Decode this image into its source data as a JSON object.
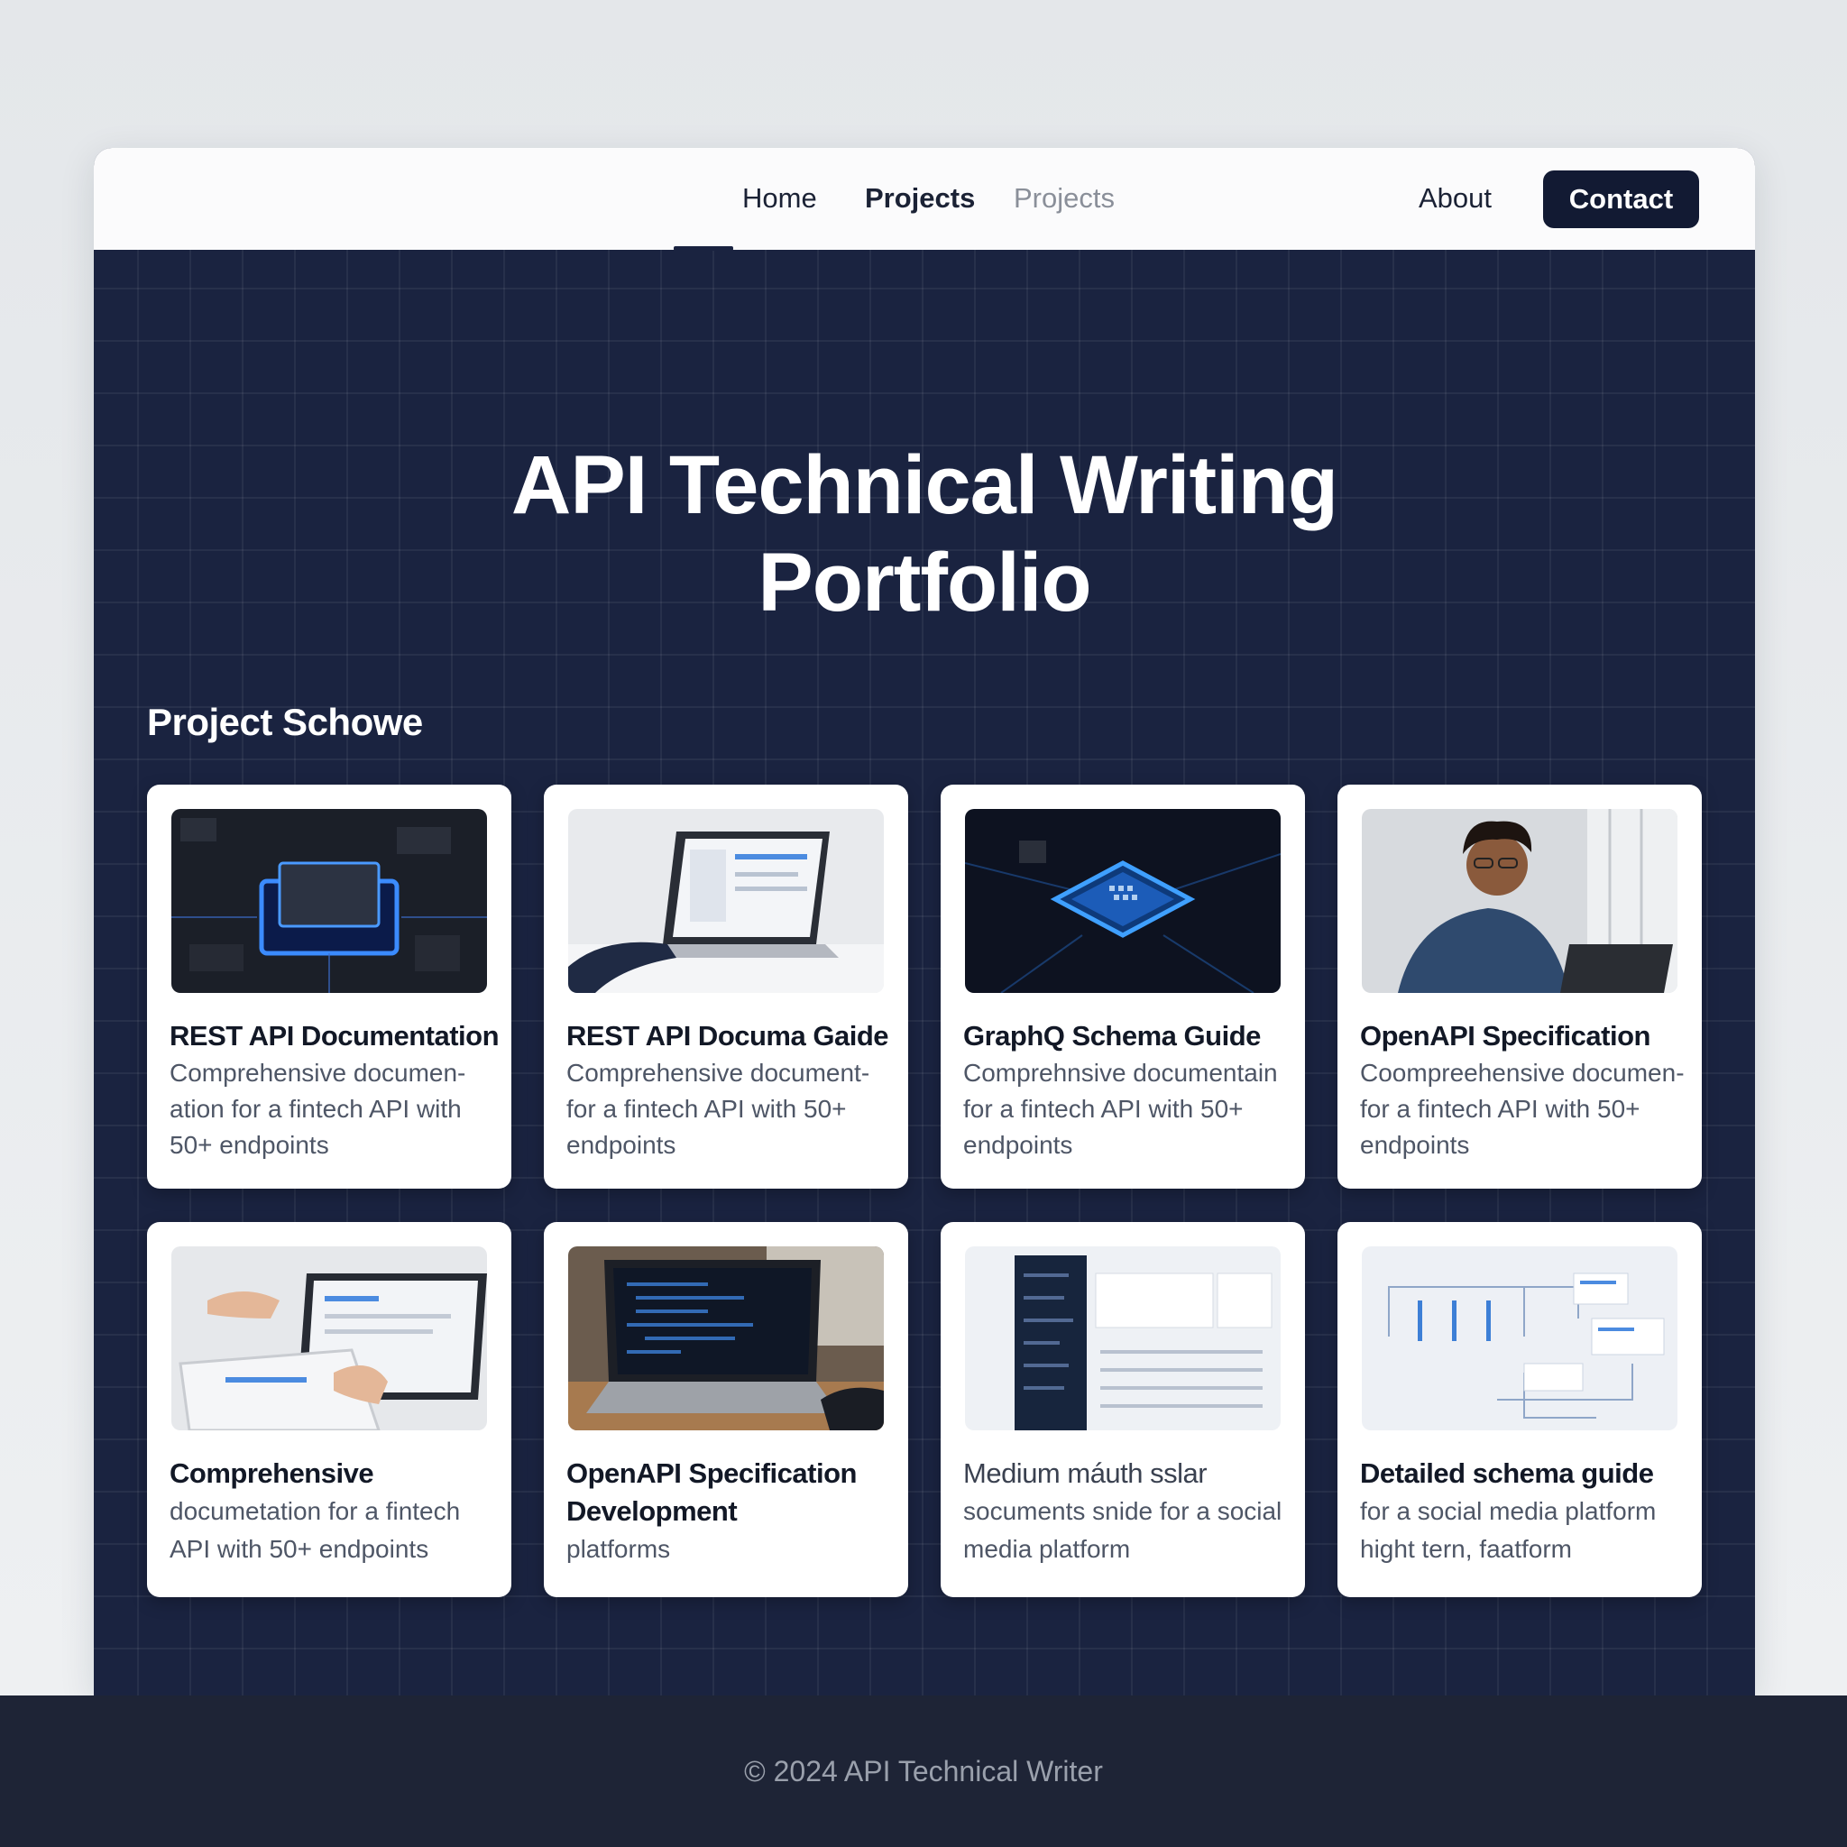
{
  "nav": {
    "links": [
      "Home",
      "Projects",
      "Projects",
      "About"
    ],
    "contact_label": "Contact"
  },
  "hero": {
    "title_line1": "API Technical Writing",
    "title_line2": "Portfolio"
  },
  "section": {
    "title": "Project Schowe"
  },
  "projects": [
    {
      "title": "REST API Documentation",
      "description": "Comprehensive documen- ation for a fintech API with 50+ endpoints",
      "image": "circuit-chip-image"
    },
    {
      "title": "REST API Documa Gaide",
      "description": "Comprehensive document- for a fintech API with 50+ endpoints",
      "image": "laptop-docs-image"
    },
    {
      "title": "GraphQ Schema Guide",
      "description": "Comprehnsive documentain for a fintech API with 50+ endpoints",
      "image": "glowing-chip-image"
    },
    {
      "title": "OpenAPI Specification",
      "description": "Coompreehensive documen- for a fintech API with 50+ endpoints",
      "image": "person-laptop-image"
    },
    {
      "title": "Comprehensive",
      "description": "documetation for a fintech API with 50+ endpoints",
      "image": "tablet-laptop-image"
    },
    {
      "title": "OpenAPI Specification Development",
      "description": "platforms",
      "image": "code-laptop-image"
    },
    {
      "title": "Medium máuth sslar",
      "description": "socuments snide for a social media platform",
      "image": "dashboard-ui-image"
    },
    {
      "title": "Detailed schema guide",
      "description": "for a social media platform hight tern, faatform",
      "image": "schema-diagram-image"
    }
  ],
  "footer": {
    "text": "© 2024 API Technical Writer"
  },
  "colors": {
    "page_bg": "#e9ecef",
    "hero_bg": "#1a2340",
    "contact_button": "#121a33",
    "footer_bg": "#1e2436",
    "card_bg": "#ffffff",
    "accent_glow": "#2f8bff"
  }
}
